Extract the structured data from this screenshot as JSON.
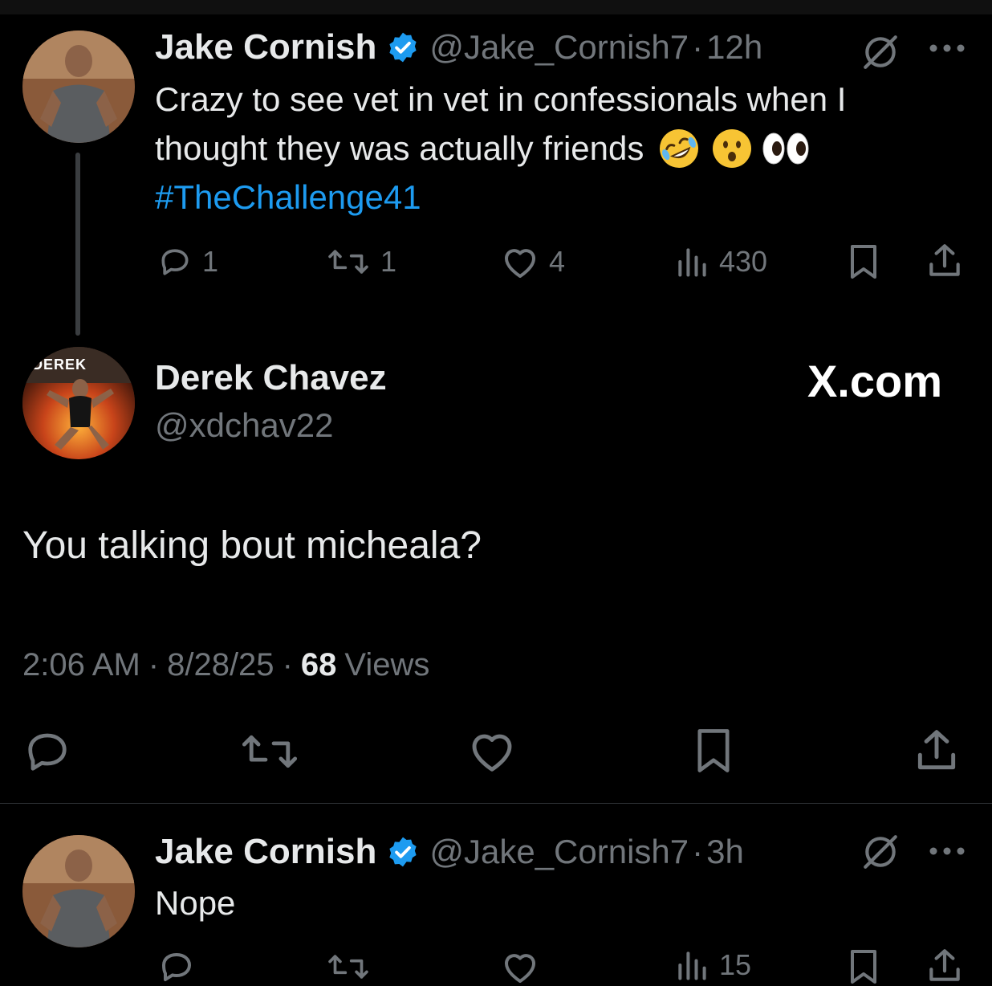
{
  "tweet1": {
    "name": "Jake Cornish",
    "handle": "@Jake_Cornish7",
    "separator": "·",
    "time": "12h",
    "text": "Crazy to see vet in vet in confessionals when I thought they was actually friends",
    "text_line1": "Crazy to see vet in vet in confessionals when I",
    "text_line2": "thought they was actually friends",
    "hashtag": "#TheChallenge41",
    "replies": "1",
    "retweets": "1",
    "likes": "4",
    "views": "430"
  },
  "main_tweet": {
    "name": "Derek Chavez",
    "handle": "@xdchav22",
    "avatar_text": "DEREK",
    "text": "You talking bout micheala?",
    "time": "2:06 AM",
    "dot1": "·",
    "date": "8/28/25",
    "dot2": "·",
    "views_count": "68",
    "views_label": "Views"
  },
  "watermark": "X.com",
  "tweet2": {
    "name": "Jake Cornish",
    "handle": "@Jake_Cornish7",
    "separator": "·",
    "time": "3h",
    "text": "Nope",
    "views": "15"
  },
  "colors": {
    "background": "#000000",
    "accent": "#1d9bf0",
    "text_primary": "#e7e9ea",
    "text_secondary": "#71767b",
    "divider": "#2f3336"
  },
  "icons": {
    "reply": "reply-icon",
    "retweet": "retweet-icon",
    "like": "heart-icon",
    "views": "views-icon",
    "bookmark": "bookmark-icon",
    "share": "share-icon",
    "grok": "grok-icon",
    "more": "more-icon",
    "verified": "verified-icon"
  }
}
